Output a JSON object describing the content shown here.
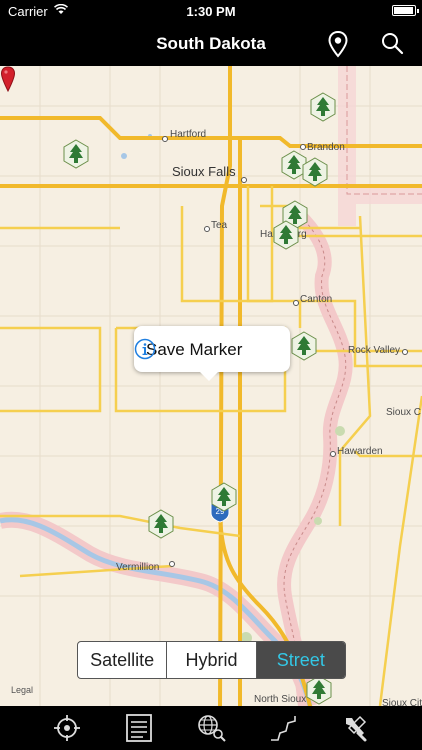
{
  "status": {
    "carrier": "Carrier",
    "time": "1:30 PM"
  },
  "nav": {
    "title": "South Dakota"
  },
  "map": {
    "cities": [
      {
        "id": "hartford",
        "name": "Hartford"
      },
      {
        "id": "brandon",
        "name": "Brandon"
      },
      {
        "id": "sioux-falls",
        "name": "Sioux Falls"
      },
      {
        "id": "tea",
        "name": "Tea"
      },
      {
        "id": "harrisburg",
        "name": "Harrisburg"
      },
      {
        "id": "canton",
        "name": "Canton"
      },
      {
        "id": "rock-valley",
        "name": "Rock Valley"
      },
      {
        "id": "sioux-center",
        "name": "Sioux C"
      },
      {
        "id": "hawarden",
        "name": "Hawarden"
      },
      {
        "id": "vermillion",
        "name": "Vermillion"
      },
      {
        "id": "north-sioux",
        "name": "North Sioux"
      },
      {
        "id": "sioux-city",
        "name": "Sioux Cit"
      }
    ],
    "interstate_shield": "29",
    "legal": "Legal"
  },
  "callout": {
    "label": "Save Marker"
  },
  "map_type": {
    "options": [
      "Satellite",
      "Hybrid",
      "Street"
    ],
    "selected": "Street"
  },
  "tabs": [
    {
      "icon": "locate-icon"
    },
    {
      "icon": "list-icon"
    },
    {
      "icon": "globe-search-icon"
    },
    {
      "icon": "route-icon"
    },
    {
      "icon": "tools-icon"
    }
  ],
  "colors": {
    "map_bg": "#f6efe2",
    "highway": "#f5c22e",
    "water": "#a7c7e6",
    "park": "#e9d3a7",
    "active_segment_text": "#33c8e6",
    "pin": "#d3202b"
  }
}
